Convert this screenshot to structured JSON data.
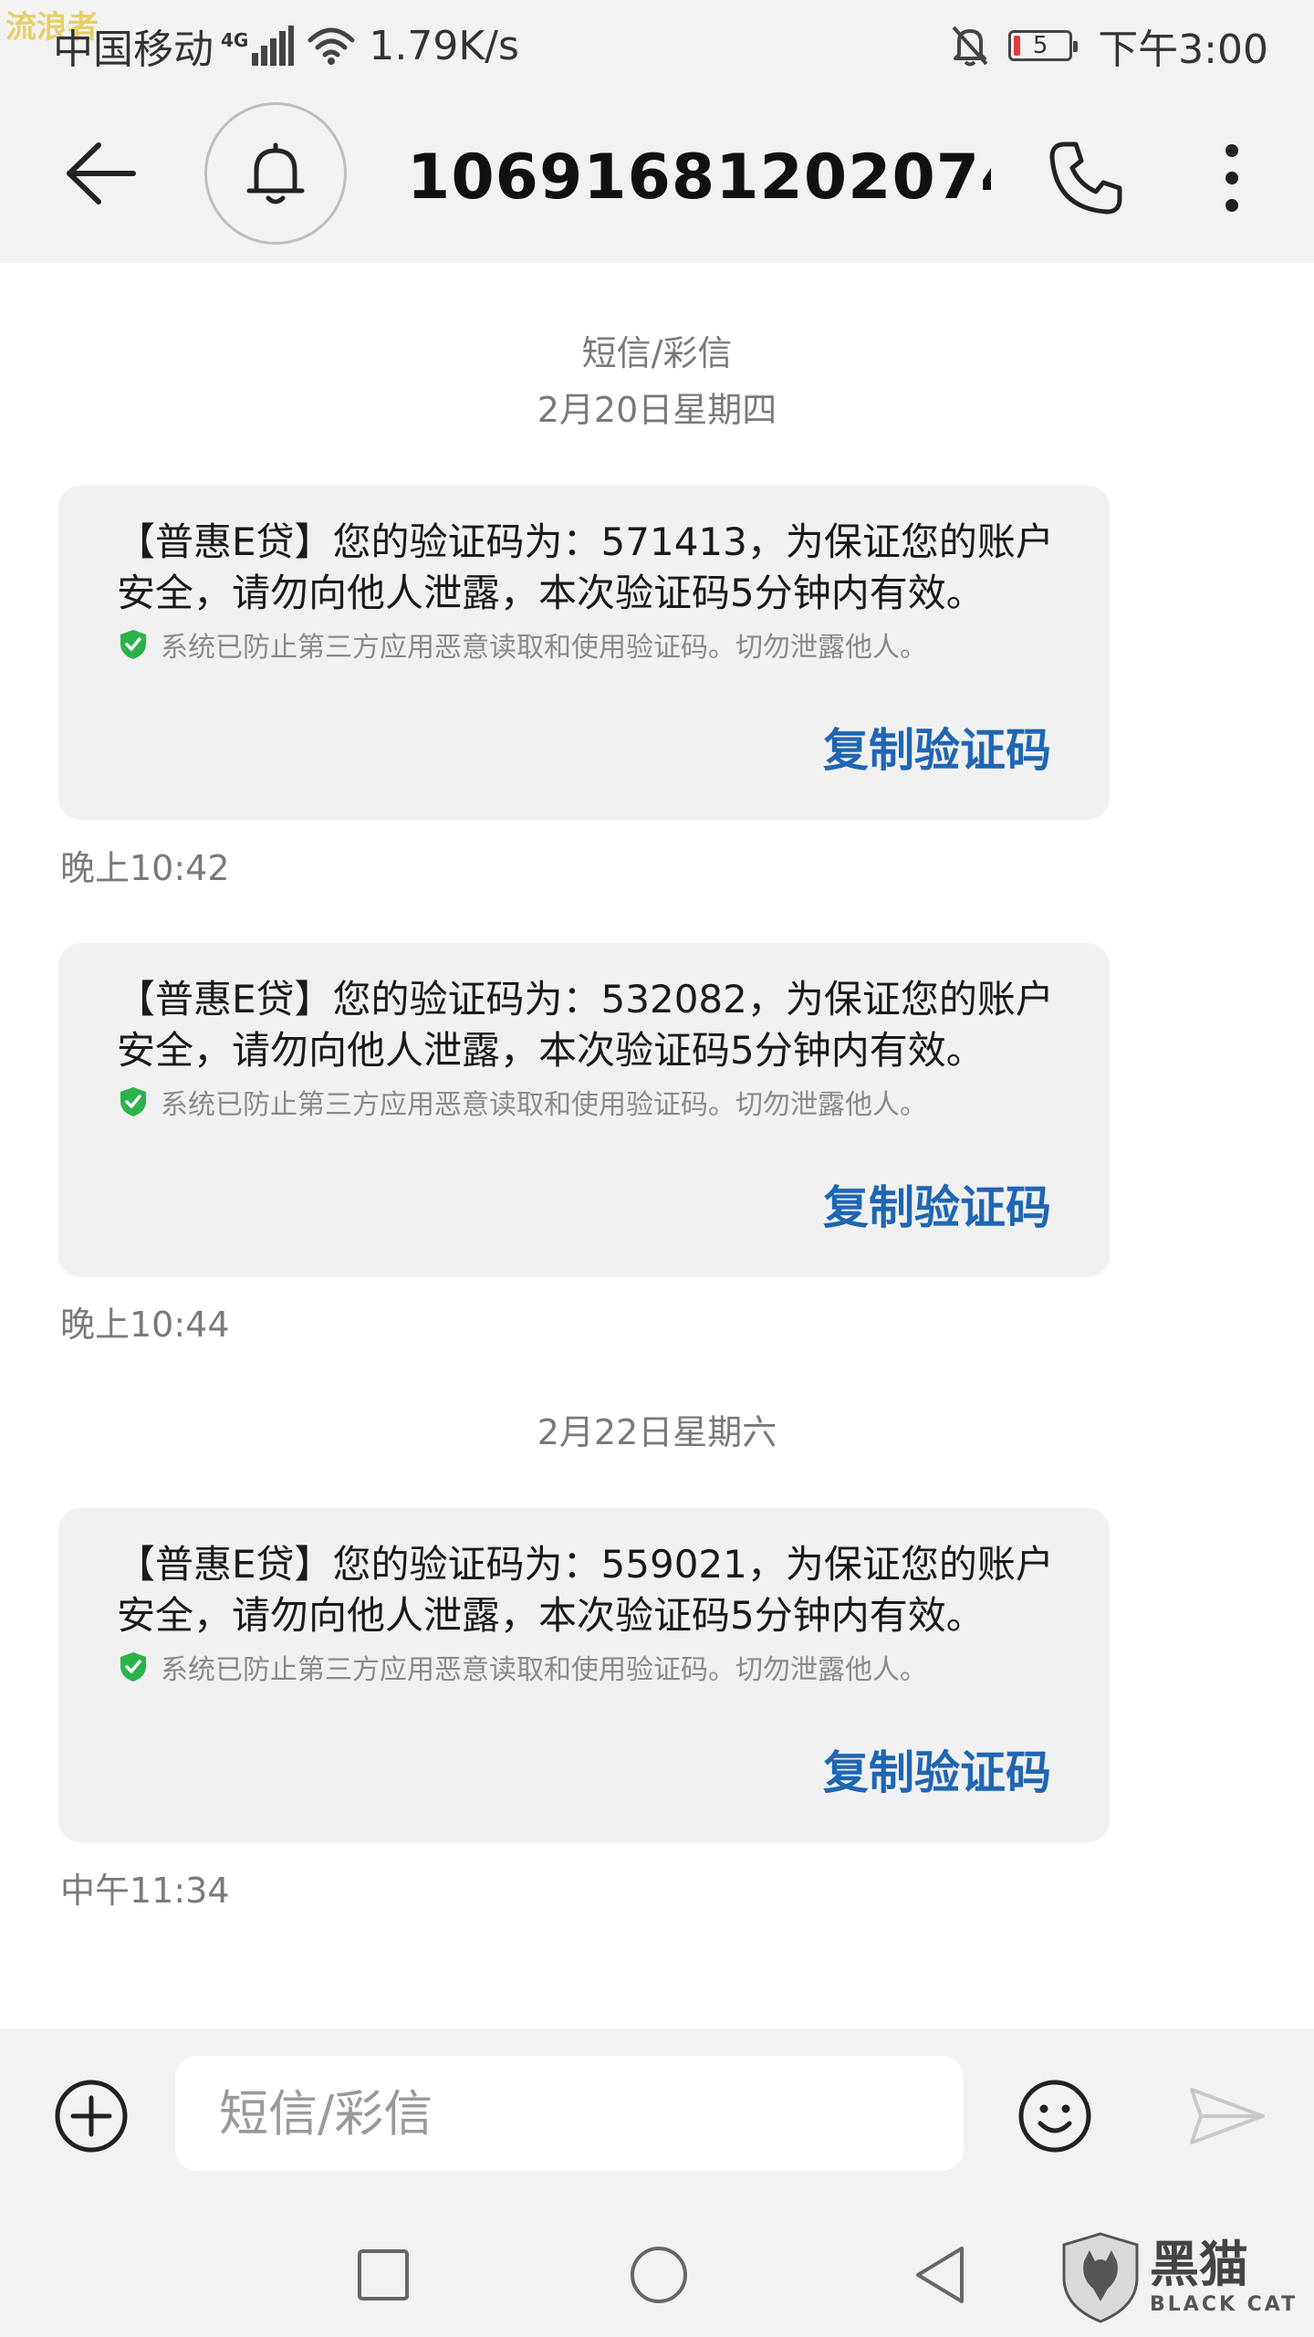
{
  "watermark": "流浪者",
  "status_bar": {
    "carrier": "中国移动",
    "network": "4G",
    "speed": "1.79K/s",
    "battery": "5",
    "time": "下午3:00"
  },
  "header": {
    "title": "10691681202074..."
  },
  "conversation": {
    "type_label": "短信/彩信",
    "groups": [
      {
        "date": "2月20日星期四",
        "messages": [
          {
            "text": "【普惠E贷】您的验证码为：571413，为保证您的账户安全，请勿向他人泄露，本次验证码5分钟内有效。",
            "notice": "系统已防止第三方应用恶意读取和使用验证码。切勿泄露他人。",
            "action": "复制验证码",
            "time": "晚上10:42"
          },
          {
            "text": "【普惠E贷】您的验证码为：532082，为保证您的账户安全，请勿向他人泄露，本次验证码5分钟内有效。",
            "notice": "系统已防止第三方应用恶意读取和使用验证码。切勿泄露他人。",
            "action": "复制验证码",
            "time": "晚上10:44"
          }
        ]
      },
      {
        "date": "2月22日星期六",
        "messages": [
          {
            "text": "【普惠E贷】您的验证码为：559021，为保证您的账户安全，请勿向他人泄露，本次验证码5分钟内有效。",
            "notice": "系统已防止第三方应用恶意读取和使用验证码。切勿泄露他人。",
            "action": "复制验证码",
            "time": "中午11:34"
          }
        ]
      }
    ]
  },
  "composer": {
    "placeholder": "短信/彩信"
  },
  "branding": {
    "cn": "黑猫",
    "en": "BLACK CAT"
  },
  "colors": {
    "accent": "#1f66b3",
    "shield": "#2bb24c",
    "bubble": "#f1f1f1",
    "bar": "#f2f2f2"
  }
}
